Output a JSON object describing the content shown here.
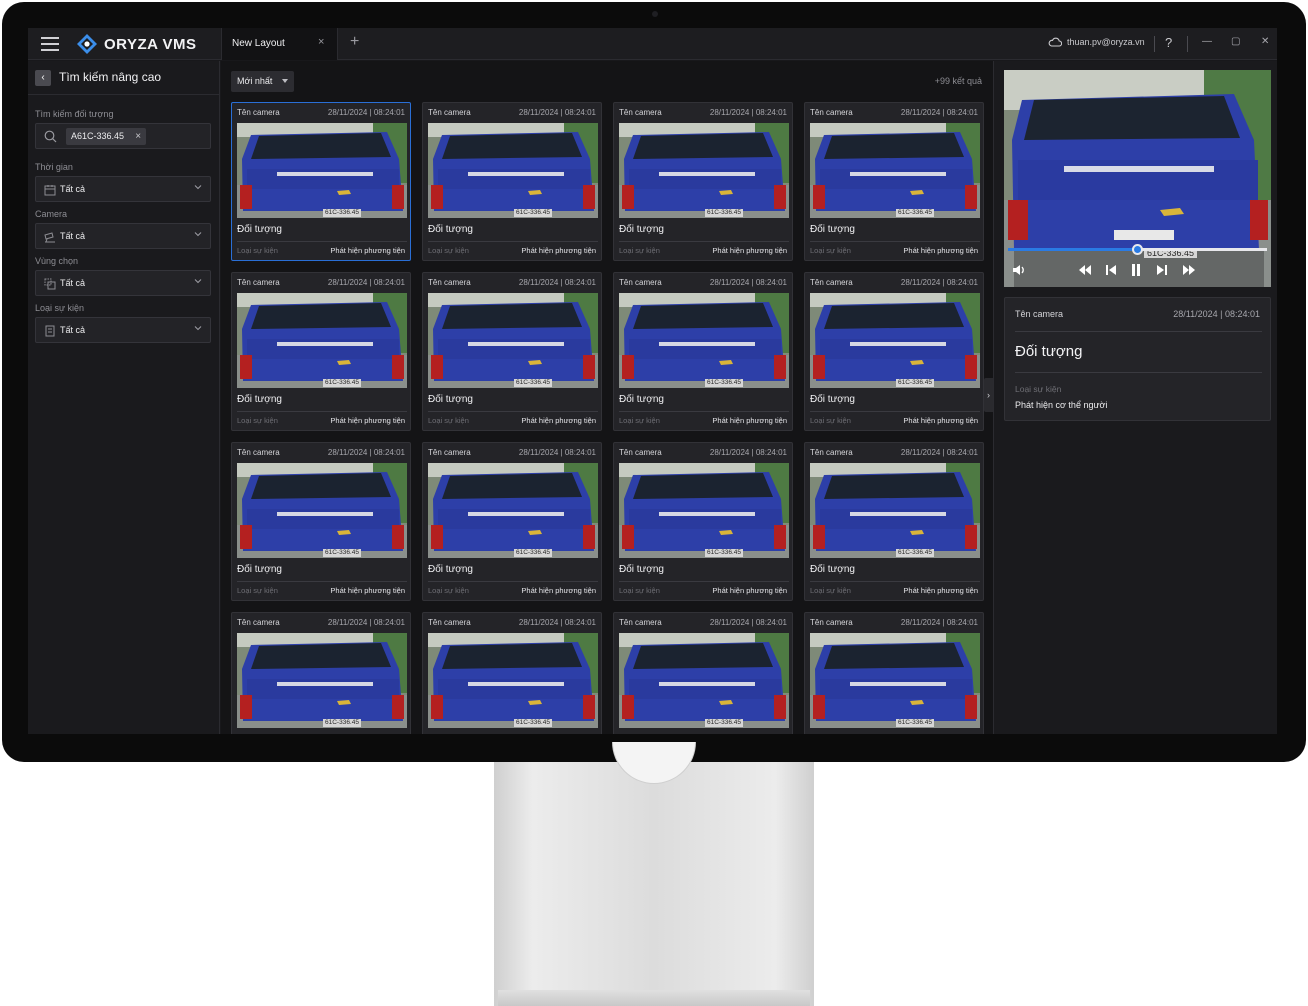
{
  "titlebar": {
    "app_name": "ORYZA VMS",
    "tab_label": "New Layout",
    "tab_close": "×",
    "tab_add": "+",
    "user_email": "thuan.pv@oryza.vn",
    "help": "?",
    "minimize": "—",
    "maximize": "▢",
    "close": "✕"
  },
  "sidebar": {
    "title": "Tìm kiếm nâng cao",
    "object_search_label": "Tìm kiếm đối tượng",
    "search_chip": "A61C-336.45",
    "chip_remove": "×",
    "filters": [
      {
        "label": "Thời gian",
        "value": "Tất cả",
        "icon": "calendar-icon"
      },
      {
        "label": "Camera",
        "value": "Tất cả",
        "icon": "camera-icon"
      },
      {
        "label": "Vùng chọn",
        "value": "Tất cả",
        "icon": "zone-icon"
      },
      {
        "label": "Loại sự kiện",
        "value": "Tất cả",
        "icon": "event-type-icon"
      }
    ]
  },
  "results": {
    "sort_label": "Mới nhất",
    "count_label": "+99 kết quả",
    "cards": [
      {
        "camera": "Tên camera",
        "time": "28/11/2024 | 08:24:01",
        "object": "Đối tượng",
        "event_label": "Loại sự kiện",
        "event_value": "Phát hiện phương tiện",
        "plate": "61C-336.45"
      },
      {
        "camera": "Tên camera",
        "time": "28/11/2024 | 08:24:01",
        "object": "Đối tượng",
        "event_label": "Loại sự kiện",
        "event_value": "Phát hiện phương tiện",
        "plate": "61C-336.45"
      },
      {
        "camera": "Tên camera",
        "time": "28/11/2024 | 08:24:01",
        "object": "Đối tượng",
        "event_label": "Loại sự kiện",
        "event_value": "Phát hiện phương tiện",
        "plate": "61C-336.45"
      },
      {
        "camera": "Tên camera",
        "time": "28/11/2024 | 08:24:01",
        "object": "Đối tượng",
        "event_label": "Loại sự kiện",
        "event_value": "Phát hiện phương tiện",
        "plate": "61C-336.45"
      },
      {
        "camera": "Tên camera",
        "time": "28/11/2024 | 08:24:01",
        "object": "Đối tượng",
        "event_label": "Loại sự kiện",
        "event_value": "Phát hiện phương tiện",
        "plate": "61C-336.45"
      },
      {
        "camera": "Tên camera",
        "time": "28/11/2024 | 08:24:01",
        "object": "Đối tượng",
        "event_label": "Loại sự kiện",
        "event_value": "Phát hiện phương tiện",
        "plate": "61C-336.45"
      },
      {
        "camera": "Tên camera",
        "time": "28/11/2024 | 08:24:01",
        "object": "Đối tượng",
        "event_label": "Loại sự kiện",
        "event_value": "Phát hiện phương tiện",
        "plate": "61C-336.45"
      },
      {
        "camera": "Tên camera",
        "time": "28/11/2024 | 08:24:01",
        "object": "Đối tượng",
        "event_label": "Loại sự kiện",
        "event_value": "Phát hiện phương tiện",
        "plate": "61C-336.45"
      },
      {
        "camera": "Tên camera",
        "time": "28/11/2024 | 08:24:01",
        "object": "Đối tượng",
        "event_label": "Loại sự kiện",
        "event_value": "Phát hiện phương tiện",
        "plate": "61C-336.45"
      },
      {
        "camera": "Tên camera",
        "time": "28/11/2024 | 08:24:01",
        "object": "Đối tượng",
        "event_label": "Loại sự kiện",
        "event_value": "Phát hiện phương tiện",
        "plate": "61C-336.45"
      },
      {
        "camera": "Tên camera",
        "time": "28/11/2024 | 08:24:01",
        "object": "Đối tượng",
        "event_label": "Loại sự kiện",
        "event_value": "Phát hiện phương tiện",
        "plate": "61C-336.45"
      },
      {
        "camera": "Tên camera",
        "time": "28/11/2024 | 08:24:01",
        "object": "Đối tượng",
        "event_label": "Loại sự kiện",
        "event_value": "Phát hiện phương tiện",
        "plate": "61C-336.45"
      },
      {
        "camera": "Tên camera",
        "time": "28/11/2024 | 08:24:01",
        "object": "",
        "event_label": "",
        "event_value": "",
        "plate": "61C-336.45"
      },
      {
        "camera": "Tên camera",
        "time": "28/11/2024 | 08:24:01",
        "object": "",
        "event_label": "",
        "event_value": "",
        "plate": "61C-336.45"
      },
      {
        "camera": "Tên camera",
        "time": "28/11/2024 | 08:24:01",
        "object": "",
        "event_label": "",
        "event_value": "",
        "plate": "61C-336.45"
      },
      {
        "camera": "Tên camera",
        "time": "28/11/2024 | 08:24:01",
        "object": "",
        "event_label": "",
        "event_value": "",
        "plate": "61C-336.45"
      }
    ]
  },
  "detail": {
    "player_plate": "61C-336.45",
    "progress": 0.5,
    "camera": "Tên camera",
    "time": "28/11/2024 | 08:24:01",
    "object": "Đối tượng",
    "event_label": "Loại sự kiện",
    "event_value": "Phát hiện cơ thể người",
    "collapse": "›"
  },
  "colors": {
    "accent": "#2a7be4",
    "selected_border": "#2a6fd6",
    "truck_blue": "#2d3fa8"
  }
}
